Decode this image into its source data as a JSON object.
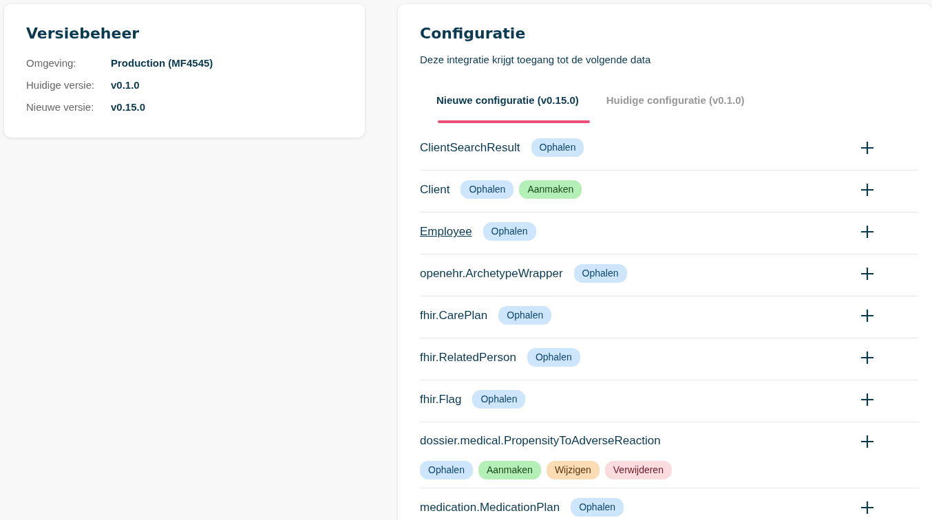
{
  "version_card": {
    "title": "Versiebeheer",
    "fields": [
      {
        "label": "Omgeving:",
        "value": "Production (MF4545)"
      },
      {
        "label": "Huidige versie:",
        "value": "v0.1.0"
      },
      {
        "label": "Nieuwe versie:",
        "value": "v0.15.0"
      }
    ]
  },
  "configuration": {
    "title": "Configuratie",
    "subtitle": "Deze integratie krijgt toegang tot de volgende data",
    "tabs": [
      {
        "label": "Nieuwe configuratie (v0.15.0)",
        "selected": true
      },
      {
        "label": "Huidige configuratie (v0.1.0)",
        "selected": false
      }
    ],
    "items": [
      {
        "name": "ClientSearchResult",
        "hovered": false,
        "tags": [
          {
            "kind": "read",
            "label": "Ophalen"
          }
        ]
      },
      {
        "name": "Client",
        "hovered": false,
        "tags": [
          {
            "kind": "read",
            "label": "Ophalen"
          },
          {
            "kind": "create",
            "label": "Aanmaken"
          }
        ]
      },
      {
        "name": "Employee",
        "hovered": true,
        "tags": [
          {
            "kind": "read",
            "label": "Ophalen"
          }
        ]
      },
      {
        "name": "openehr.ArchetypeWrapper",
        "hovered": false,
        "tags": [
          {
            "kind": "read",
            "label": "Ophalen"
          }
        ]
      },
      {
        "name": "fhir.CarePlan",
        "hovered": false,
        "tags": [
          {
            "kind": "read",
            "label": "Ophalen"
          }
        ]
      },
      {
        "name": "fhir.RelatedPerson",
        "hovered": false,
        "tags": [
          {
            "kind": "read",
            "label": "Ophalen"
          }
        ]
      },
      {
        "name": "fhir.Flag",
        "hovered": false,
        "tags": [
          {
            "kind": "read",
            "label": "Ophalen"
          }
        ]
      },
      {
        "name": "dossier.medical.PropensityToAdverseReaction",
        "hovered": false,
        "tags": [
          {
            "kind": "read",
            "label": "Ophalen"
          },
          {
            "kind": "create",
            "label": "Aanmaken"
          },
          {
            "kind": "update",
            "label": "Wijzigen"
          },
          {
            "kind": "delete",
            "label": "Verwijderen"
          }
        ]
      },
      {
        "name": "medication.MedicationPlan",
        "hovered": false,
        "tags": [
          {
            "kind": "read",
            "label": "Ophalen"
          }
        ]
      }
    ]
  }
}
